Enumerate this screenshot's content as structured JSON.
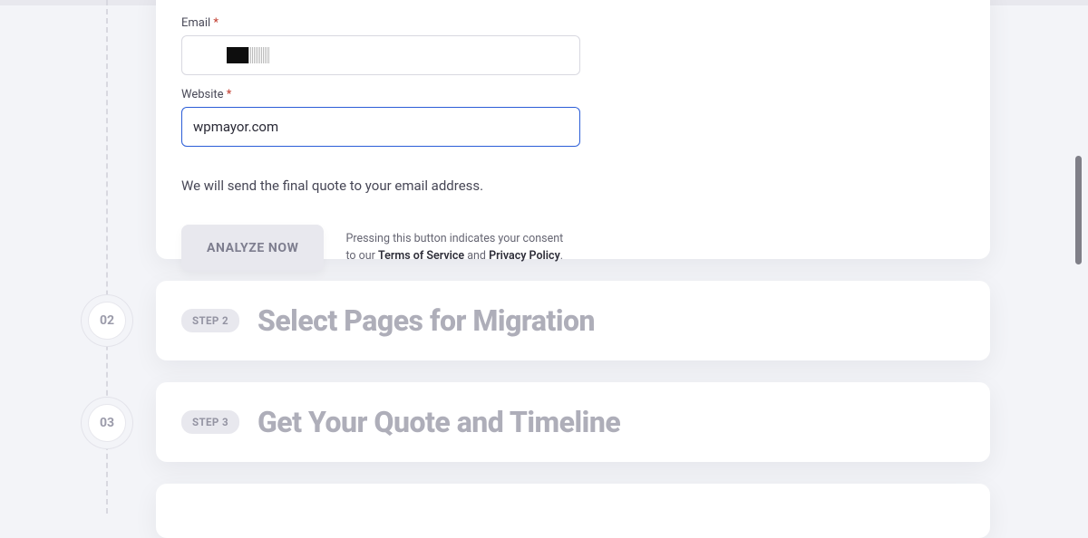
{
  "form": {
    "email_label": "Email",
    "email_value": "",
    "website_label": "Website",
    "website_value": "wpmayor.com",
    "required_mark": "*",
    "note": "We will send the final quote to your email address.",
    "analyze_button": "ANALYZE NOW",
    "consent_prefix": "Pressing this button indicates your consent to our ",
    "tos_label": "Terms of Service",
    "consent_and": " and ",
    "privacy_label": "Privacy Policy",
    "consent_suffix": "."
  },
  "steps": [
    {
      "num": "02",
      "pill": "STEP 2",
      "title": "Select Pages for Migration"
    },
    {
      "num": "03",
      "pill": "STEP 3",
      "title": "Get Your Quote and Timeline"
    }
  ]
}
